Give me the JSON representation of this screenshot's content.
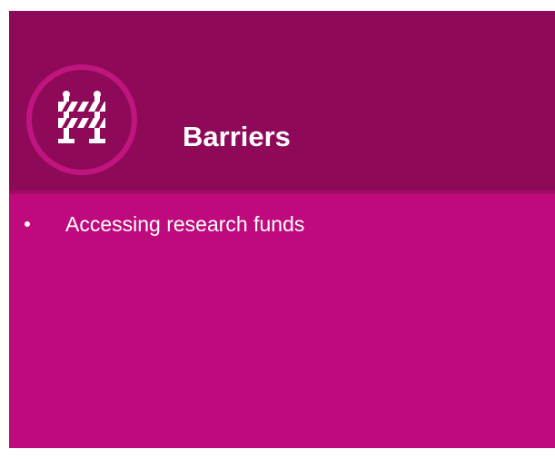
{
  "slide": {
    "title": "Barriers",
    "icon": "road-barrier-icon",
    "bullets": [
      "Accessing research funds"
    ]
  },
  "colors": {
    "header_background": "#8f0959",
    "body_background": "#be0a7c",
    "icon_ring": "#c0157f",
    "text": "#ffffff"
  }
}
